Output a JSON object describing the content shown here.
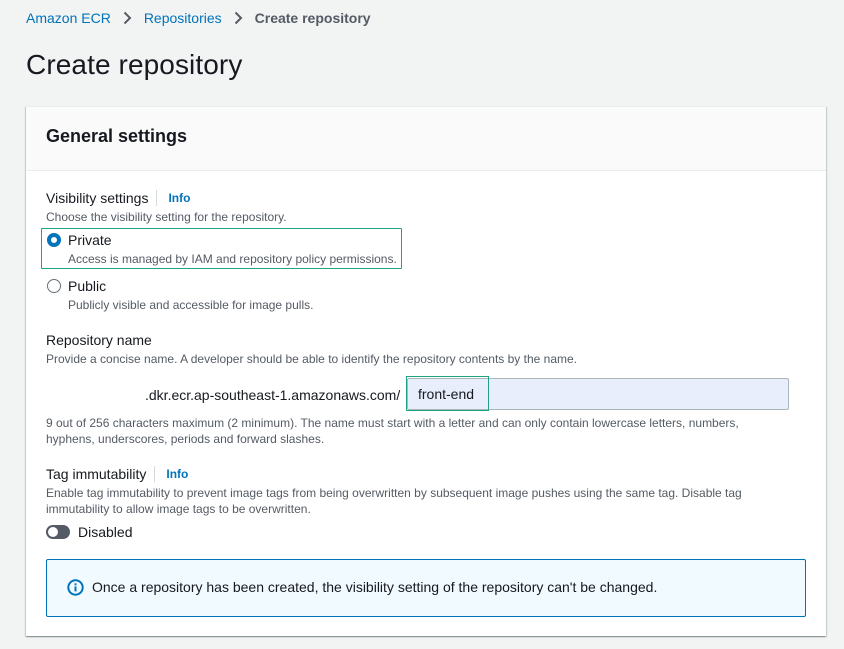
{
  "breadcrumb": {
    "items": [
      {
        "label": "Amazon ECR"
      },
      {
        "label": "Repositories"
      },
      {
        "label": "Create repository"
      }
    ]
  },
  "page": {
    "title": "Create repository"
  },
  "panel": {
    "title": "General settings"
  },
  "visibility": {
    "label": "Visibility settings",
    "info": "Info",
    "description": "Choose the visibility setting for the repository.",
    "options": [
      {
        "label": "Private",
        "description": "Access is managed by IAM and repository policy permissions.",
        "selected": true
      },
      {
        "label": "Public",
        "description": "Publicly visible and accessible for image pulls.",
        "selected": false
      }
    ]
  },
  "repository_name": {
    "label": "Repository name",
    "description": "Provide a concise name. A developer should be able to identify the repository contents by the name.",
    "prefix": ".dkr.ecr.ap-southeast-1.amazonaws.com/",
    "value": "front-end",
    "constraint_line1": "9 out of 256 characters maximum (2 minimum). The name must start with a letter and can only contain lowercase letters, numbers,",
    "constraint_line2": "hyphens, underscores, periods and forward slashes."
  },
  "tag_immutability": {
    "label": "Tag immutability",
    "info": "Info",
    "description_line1": "Enable tag immutability to prevent image tags from being overwritten by subsequent image pushes using the same tag. Disable tag",
    "description_line2": "immutability to allow image tags to be overwritten.",
    "toggle_label": "Disabled",
    "enabled": false
  },
  "alert": {
    "text": "Once a repository has been created, the visibility setting of the repository can't be changed.",
    "icon": "info-circle-icon"
  },
  "colors": {
    "link": "#0073bb",
    "highlight_border": "#1fa382",
    "input_bg": "#e8eefb",
    "alert_bg": "#f1faff"
  }
}
